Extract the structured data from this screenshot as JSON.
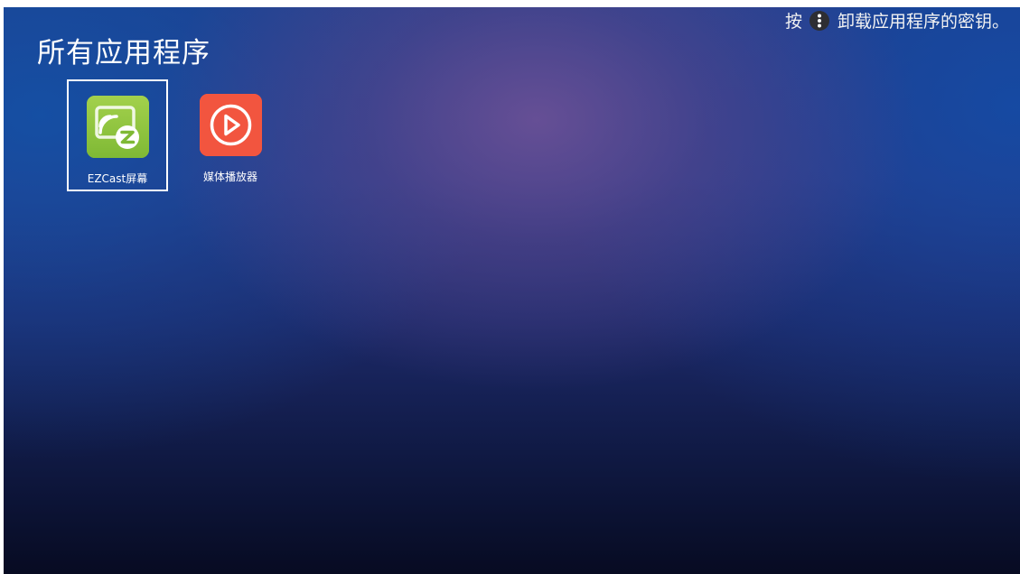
{
  "header": {
    "title": "所有应用程序",
    "hint_prefix": "按",
    "hint_suffix": "卸载应用程序的密钥。",
    "hint_key_icon": "more-vertical-icon"
  },
  "apps": [
    {
      "label": "EZCast屏幕",
      "icon": "ezcast-screen-icon",
      "color": "#8dc63f",
      "focused": true
    },
    {
      "label": "媒体播放器",
      "icon": "play-circle-icon",
      "color": "#f2553f",
      "focused": false
    }
  ],
  "colors": {
    "text": "#ffffff",
    "focus_border": "#ffffff",
    "background_top": "#1f3f8c",
    "background_bottom": "#070b22"
  }
}
